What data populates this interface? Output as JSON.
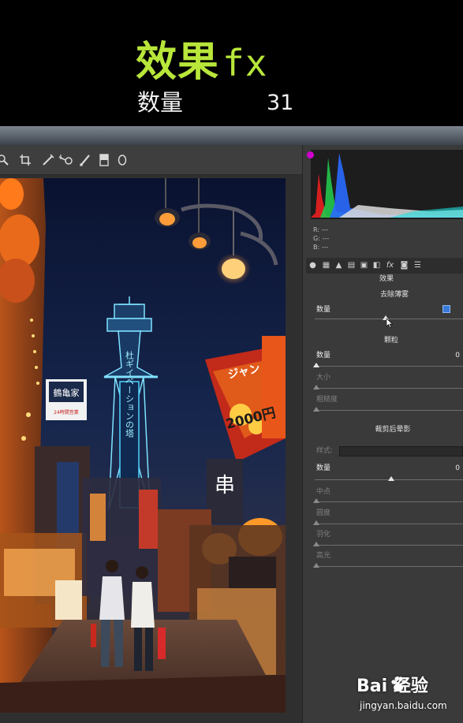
{
  "caption": {
    "title": "效果",
    "title_fx": "fx",
    "subtitle": "数量",
    "value": "31"
  },
  "toolbar": {
    "tools": [
      "zoom-tool",
      "crop-tool",
      "straighten-tool",
      "spot-removal-tool",
      "adjustment-brush-tool",
      "graduated-filter-tool",
      "radial-filter-tool"
    ]
  },
  "photo": {
    "signs": {
      "vertical_blue": "杜ギイベーションの塔",
      "shop_sign": "鶴亀家",
      "shop_sub": "24時間営業",
      "banner_left": "ジャン",
      "banner_num": "2000円",
      "banner_char": "串"
    }
  },
  "panel": {
    "rgb_readout": [
      {
        "label": "R:",
        "value": "---"
      },
      {
        "label": "G:",
        "value": "---"
      },
      {
        "label": "B:",
        "value": "---"
      }
    ],
    "tab_icons": [
      "basic-tab",
      "tone-curve-tab",
      "detail-tab",
      "hsl-tab",
      "split-toning-tab",
      "lens-tab",
      "effects-fx-tab",
      "camera-calibration-tab",
      "presets-tab"
    ],
    "section_title": "效果",
    "dehaze": {
      "title": "去除薄雾",
      "amount_label": "数量",
      "amount_value": "31"
    },
    "grain": {
      "title": "颗粒",
      "amount_label": "数量",
      "amount_value": "0",
      "size_label": "大小",
      "roughness_label": "粗糙度"
    },
    "vignette": {
      "title": "裁剪后晕影",
      "style_label": "样式:",
      "amount_label": "数量",
      "amount_value": "0",
      "midpoint_label": "中点",
      "roundness_label": "圆度",
      "feather_label": "羽化",
      "highlights_label": "高光"
    }
  },
  "watermark": {
    "logo": "Bai  经验",
    "url": "jingyan.baidu.com"
  },
  "colors": {
    "caption_green": "#b8e63a",
    "panel_bg": "#3a3a3a",
    "neon_blue": "#4fd4ff",
    "lantern_orange": "#ff7a1a"
  }
}
